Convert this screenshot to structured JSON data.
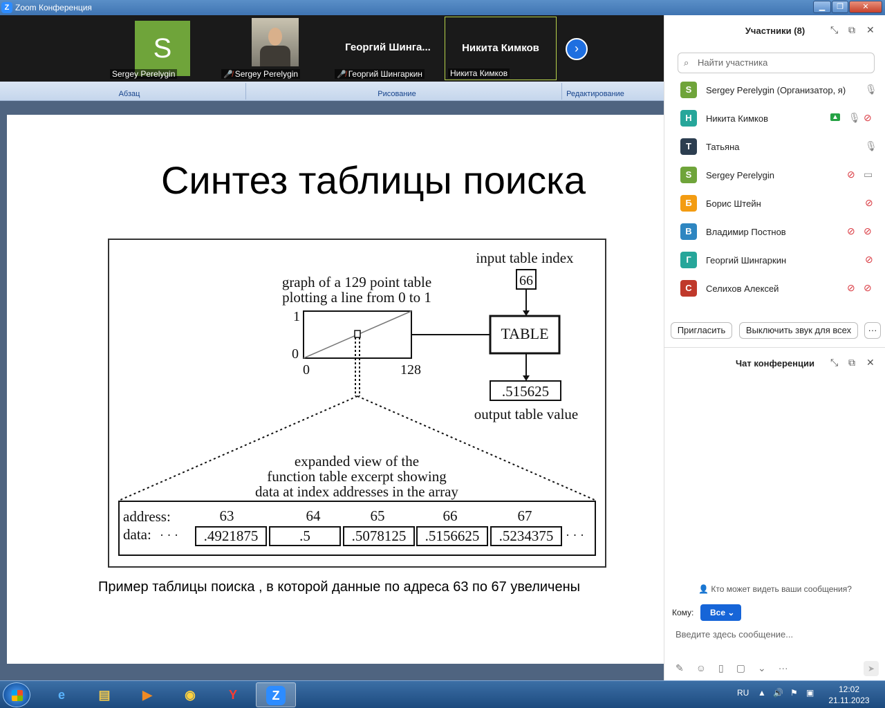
{
  "window": {
    "title": "Zoom Конференция"
  },
  "video_strip": {
    "tiles": [
      {
        "name": "Sergey Perelygin",
        "avatar_letter": "S",
        "muted": false
      },
      {
        "name": "Sergey Perelygin",
        "muted": true
      },
      {
        "name": "Георгий Шингаркин",
        "big_name": "Георгий  Шинга...",
        "muted": true
      },
      {
        "name": "Никита Кимков",
        "big_name": "Никита Кимков",
        "muted": false
      }
    ],
    "next_icon": "chevron-right-icon"
  },
  "ribbon": {
    "groups": [
      "Абзац",
      "Рисование",
      "Редактирование"
    ]
  },
  "slide": {
    "title": "Синтез таблицы поиска",
    "caption": "Пример таблицы поиска , в которой данные по адреса 63 по 67 увеличены",
    "figure": {
      "graph_label_1": "graph of a 129 point table",
      "graph_label_2": "plotting a line from 0 to 1",
      "y_max": "1",
      "y_min": "0",
      "x_min": "0",
      "x_max": "128",
      "input_label": "input table index",
      "input_value": "66",
      "table_label": "TABLE",
      "output_value": ".515625",
      "output_label": "output table value",
      "expanded_1": "expanded view of the",
      "expanded_2": "function table excerpt showing",
      "expanded_3": "data at index addresses in the array",
      "address_label": "address:",
      "data_label": "data:",
      "dots": "· · ·",
      "addresses": [
        "63",
        "64",
        "65",
        "66",
        "67"
      ],
      "values": [
        ".4921875",
        ".5",
        ".5078125",
        ".5156625",
        ".5234375"
      ]
    }
  },
  "participants_panel": {
    "title": "Участники (8)",
    "search_placeholder": "Найти участника",
    "participants": [
      {
        "name": "Sergey Perelygin (Организатор, я)",
        "initial": "S",
        "color": "#6fa43a"
      },
      {
        "name": "Никита Кимков",
        "initial": "Н",
        "color": "#26a69a"
      },
      {
        "name": "Татьяна",
        "initial": "Т",
        "color": "#2c3e50"
      },
      {
        "name": "Sergey Perelygin",
        "initial": "S",
        "color": "#6fa43a"
      },
      {
        "name": "Борис Штейн",
        "initial": "Б",
        "color": "#f39c12"
      },
      {
        "name": "Владимир Постнов",
        "initial": "В",
        "color": "#2e86c1"
      },
      {
        "name": "Георгий Шингаркин",
        "initial": "Г",
        "color": "#26a69a"
      },
      {
        "name": "Селихов Алексей",
        "initial": "С",
        "color": "#c0392b"
      }
    ],
    "invite_label": "Пригласить",
    "mute_all_label": "Выключить звук для всех",
    "more_label": "···"
  },
  "chat_panel": {
    "title": "Чат конференции",
    "who_can_see": "Кто может видеть ваши сообщения?",
    "to_label": "Кому:",
    "to_value": "Все",
    "message_placeholder": "Введите здесь сообщение..."
  },
  "taskbar": {
    "language": "RU",
    "time": "12:02",
    "date": "21.11.2023"
  }
}
